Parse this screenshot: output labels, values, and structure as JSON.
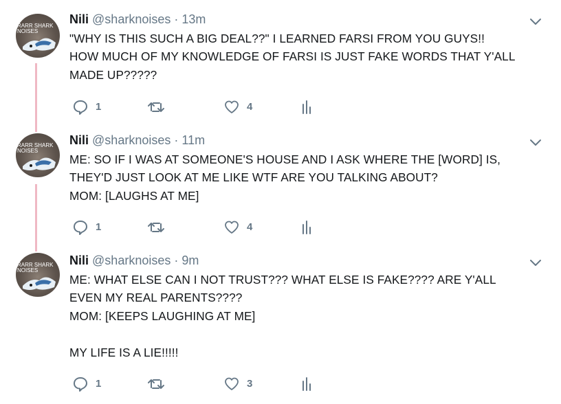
{
  "tweets": [
    {
      "name": "Nili",
      "handle": "@sharknoises",
      "separator": "·",
      "time": "13m",
      "lines": [
        "\"WHY IS THIS SUCH A BIG DEAL??\" I LEARNED FARSI FROM YOU GUYS!!",
        "HOW MUCH OF MY KNOWLEDGE OF FARSI IS JUST FAKE WORDS THAT Y'ALL",
        "MADE UP?????"
      ],
      "replies": "1",
      "likes": "4"
    },
    {
      "name": "Nili",
      "handle": "@sharknoises",
      "separator": "·",
      "time": "11m",
      "lines": [
        "ME: SO IF I WAS AT SOMEONE'S HOUSE AND I ASK WHERE THE [WORD] IS,",
        "THEY'D JUST LOOK AT ME LIKE WTF ARE YOU TALKING ABOUT?",
        "MOM: [LAUGHS AT ME]"
      ],
      "replies": "1",
      "likes": "4"
    },
    {
      "name": "Nili",
      "handle": "@sharknoises",
      "separator": "·",
      "time": "9m",
      "lines": [
        "ME: WHAT ELSE CAN I NOT TRUST??? WHAT ELSE IS FAKE???? ARE Y'ALL",
        "EVEN MY REAL PARENTS????",
        "MOM: [KEEPS LAUGHING AT ME]",
        "",
        "MY LIFE IS A LIE!!!!!"
      ],
      "replies": "1",
      "likes": "3"
    }
  ],
  "avatar": {
    "text_line1": "RARR SHARK",
    "text_line2": "NOISES"
  },
  "icons": {
    "reply": "reply-icon",
    "retweet": "retweet-icon",
    "like": "heart-icon",
    "analytics": "analytics-icon",
    "menu": "chevron-down-icon"
  },
  "colors": {
    "thread_line": "#efb8c4",
    "icon_gray": "#657786",
    "text": "#14171a"
  }
}
